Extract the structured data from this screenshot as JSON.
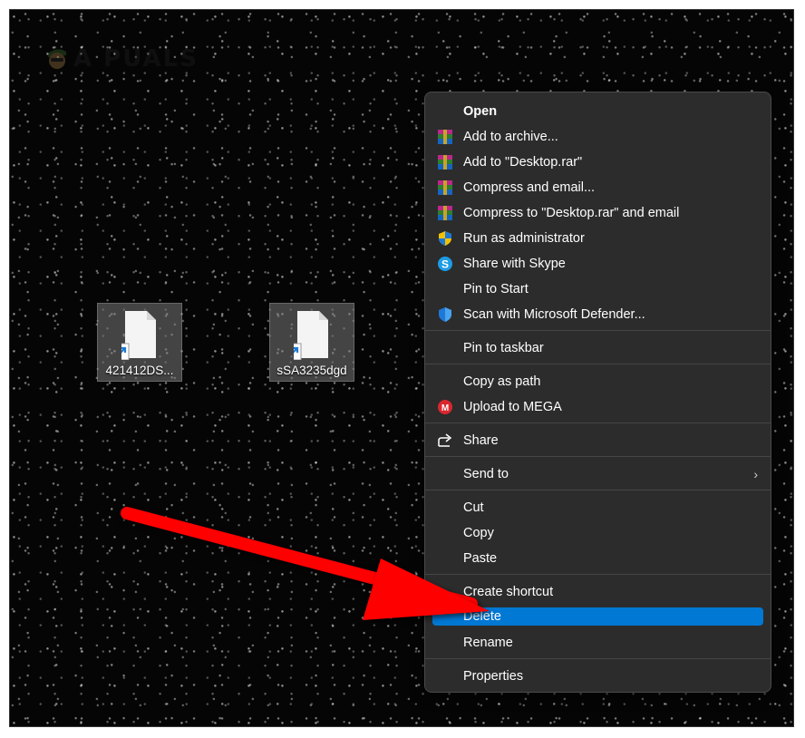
{
  "watermark": {
    "logo_text": "A PUALS"
  },
  "desktop_icons": [
    {
      "label": "421412DS...",
      "icon": "file-shortcut-icon"
    },
    {
      "label": "sSA3235dgd",
      "icon": "file-shortcut-icon"
    }
  ],
  "context_menu": {
    "items": {
      "open": "Open",
      "add_archive": "Add to archive...",
      "add_desktop_rar": "Add to \"Desktop.rar\"",
      "compress_email": "Compress and email...",
      "compress_desktop_email": "Compress to \"Desktop.rar\" and email",
      "run_admin": "Run as administrator",
      "share_skype": "Share with Skype",
      "pin_start": "Pin to Start",
      "scan_defender": "Scan with Microsoft Defender...",
      "pin_taskbar": "Pin to taskbar",
      "copy_path": "Copy as path",
      "upload_mega": "Upload to MEGA",
      "share": "Share",
      "send_to": "Send to",
      "cut": "Cut",
      "copy": "Copy",
      "paste": "Paste",
      "create_shortcut": "Create shortcut",
      "delete": "Delete",
      "rename": "Rename",
      "properties": "Properties"
    },
    "selected": "Delete",
    "colors": {
      "menu_bg": "#2c2c2c",
      "highlight": "#0078d4",
      "annotation_arrow": "#ff0000"
    }
  }
}
